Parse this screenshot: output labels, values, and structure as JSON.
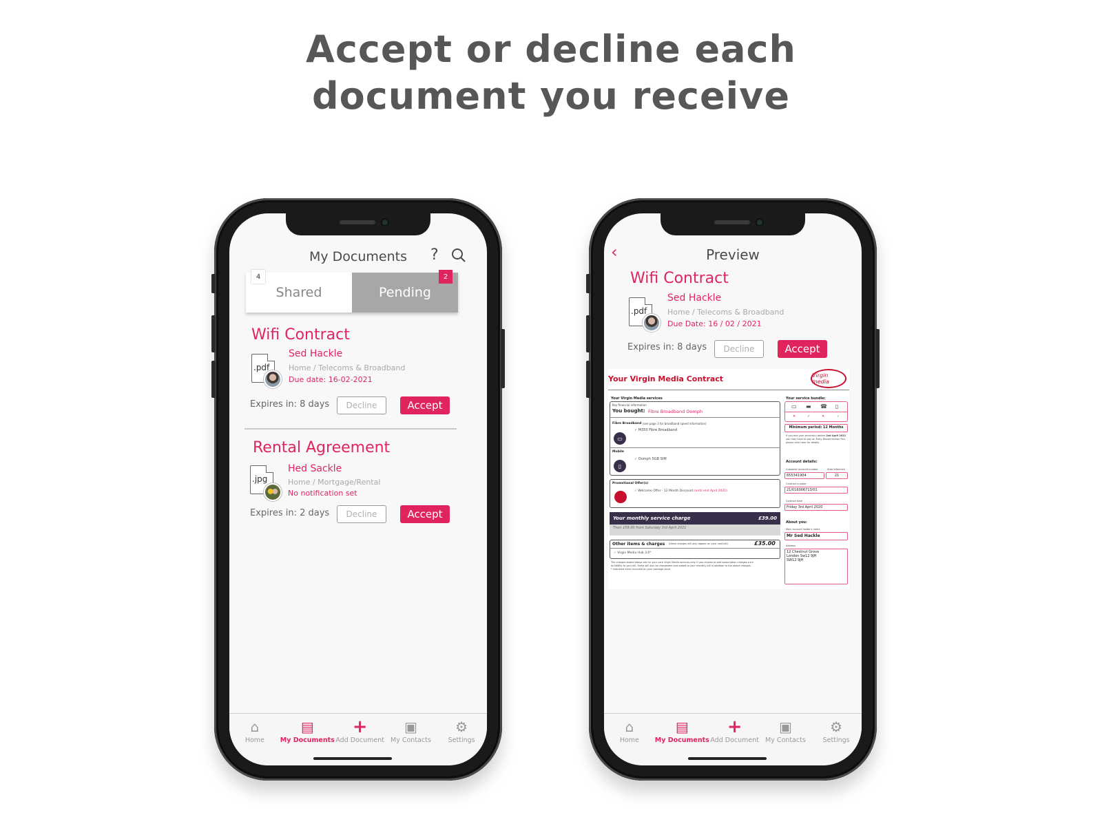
{
  "headline": {
    "line1": "Accept or decline each",
    "line2": "document you receive"
  },
  "colors": {
    "accent": "#e0245e",
    "tab_active_bg": "#a7a7a7",
    "text_grey": "#a9a9a9"
  },
  "nav": {
    "items": [
      {
        "label": "Home",
        "icon": "home-icon"
      },
      {
        "label": "My Documents",
        "icon": "document-icon"
      },
      {
        "label": "Add Document",
        "icon": "plus-icon"
      },
      {
        "label": "My Contacts",
        "icon": "contacts-icon"
      },
      {
        "label": "Settings",
        "icon": "gear-icon"
      }
    ],
    "active": "My Documents"
  },
  "screen1": {
    "title": "My Documents",
    "help_glyph": "?",
    "tabs": {
      "shared": {
        "label": "Shared",
        "count": "4"
      },
      "pending": {
        "label": "Pending",
        "count": "2"
      }
    },
    "documents": [
      {
        "title": "Wifi Contract",
        "ext": ".pdf",
        "sender": "Sed Hackle",
        "path": "Home / Telecoms & Broadband",
        "due": "Due date: 16-02-2021",
        "expires": "Expires in: 8 days",
        "decline": "Decline",
        "accept": "Accept"
      },
      {
        "title": "Rental Agreement",
        "ext": ".jpg",
        "sender": "Hed Sackle",
        "path": "Home / Mortgage/Rental",
        "due": "No notification set",
        "expires": "Expires in: 2 days",
        "decline": "Decline",
        "accept": "Accept"
      }
    ]
  },
  "screen2": {
    "title": "Preview",
    "document": {
      "title": "Wifi Contract",
      "ext": ".pdf",
      "sender": "Sed Hackle",
      "path": "Home / Telecoms & Broadband",
      "due": "Due Date: 16 / 02 / 2021",
      "expires": "Expires in: 8 days",
      "decline": "Decline",
      "accept": "Accept"
    },
    "contract": {
      "title": "Your Virgin Media Contract",
      "logo": "Virgin media",
      "services_heading": "Your Virgin Media services",
      "key_financial": "Key financial information",
      "you_bought_label": "You bought:",
      "you_bought_value": "Fibre Broadband Oomph",
      "fibre_label": "Fibre Broadband",
      "fibre_note": "(see page 3 for broadband speed information)",
      "fibre_item": "M350 Fibre Broadband",
      "mobile_label": "Mobile",
      "mobile_item": "Oomph 5GB SIM",
      "promo_label": "Promotional Offer(s)",
      "promo_item": "Welcome Offer - 12 Month Discount",
      "promo_note": "(until end April 2021)",
      "monthly_label": "Your monthly service charge",
      "monthly_value": "£39.00",
      "then_text": "Then £59.00 from Saturday 3rd April 2021",
      "other_label": "Other items & charges",
      "other_note": "(these charges will only appear on your next bill)",
      "other_value": "£35.00",
      "other_item": "Virgin Media Hub 3.0*",
      "footnote1": "The charges stated above are for your core Virgin Media services only. If you choose to add subscription charges such",
      "footnote2": "as Netflix to your bill, these will also be chargeable and added to your monthly bill in addition to the above charges.",
      "footnote3": "* Indicated items included on your package price.",
      "bundle_heading": "Your service bundle:",
      "bundle_icons": [
        "tv-icon",
        "laptop-icon",
        "phone-icon",
        "sim-icon"
      ],
      "bundle_marks": [
        "✕",
        "✓",
        "✕",
        "✓"
      ],
      "min_period_label": "Minimum period:",
      "min_period_value": "12 Months",
      "early_note1": "If you end your service(s) before",
      "early_note_date": "2nd April 2021",
      "early_note2": "you may have to pay an Early Disconnection Fee,",
      "early_note3": "please click here for details.",
      "account_heading": "Account details:",
      "customer_no_label": "Customer account number",
      "customer_no": "655341904",
      "area_ref_label": "Area reference",
      "area_ref": "21",
      "contract_no_label": "Contract number",
      "contract_no": "21/016006713/01",
      "contract_date_label": "Contract date",
      "contract_date": "Friday 3rd April 2020",
      "about_heading": "About you:",
      "holder_label": "Main account holder's name",
      "holder": "Mr Sed Hackle",
      "address_label": "Address",
      "address1": "12   Chestnut Grove",
      "address2": "London  Sw12 9JH",
      "address3": "SW12 9JH"
    }
  }
}
